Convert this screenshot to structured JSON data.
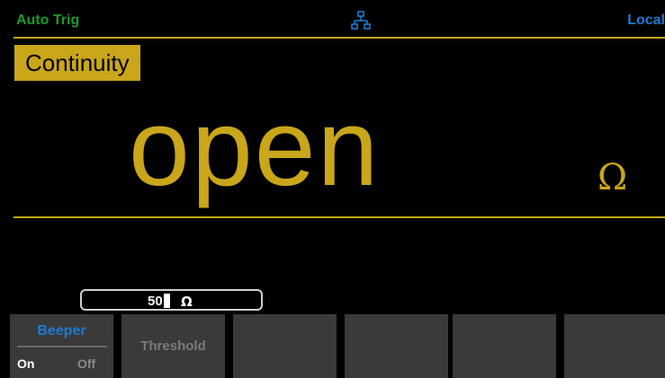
{
  "status": {
    "trigger": "Auto Trig",
    "remote_state": "Local",
    "network_icon": "lan-icon",
    "colors": {
      "trigger": "#1d9a2a",
      "remote": "#1b7bd4",
      "accent": "#c9a61a"
    }
  },
  "mode": {
    "label": "Continuity"
  },
  "reading": {
    "value": "open",
    "unit": "Ω"
  },
  "threshold_entry": {
    "value": "50",
    "unit": "Ω"
  },
  "softkeys": {
    "beeper": {
      "title": "Beeper",
      "on": "On",
      "off": "Off",
      "selected": "On"
    },
    "threshold": {
      "label": "Threshold"
    },
    "empty": [
      "",
      "",
      "",
      ""
    ]
  }
}
